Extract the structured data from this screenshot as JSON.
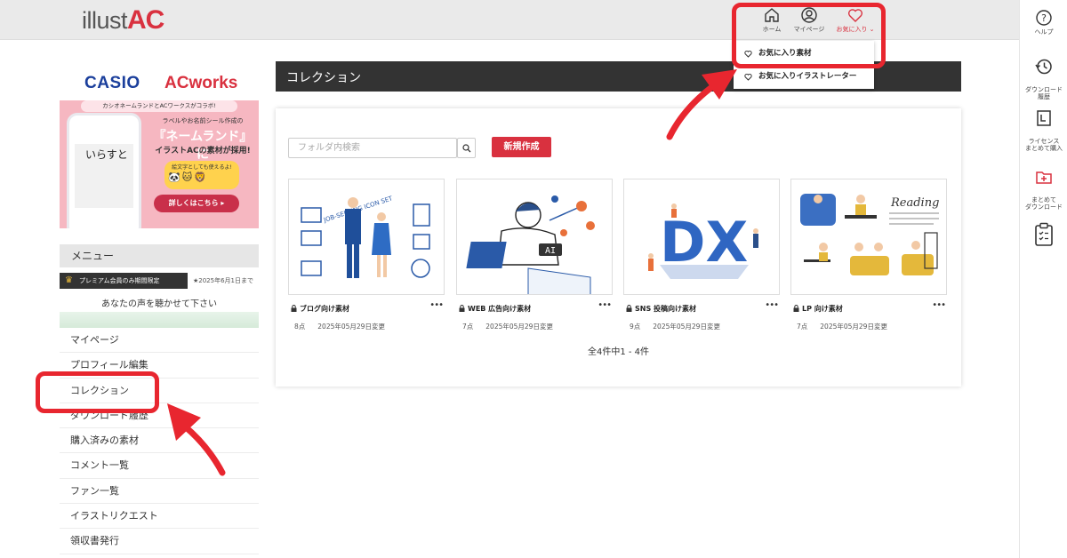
{
  "header": {
    "logo_text": "illust",
    "logo_accent": "AC",
    "nav": [
      {
        "label": "ホーム",
        "icon": "home-icon"
      },
      {
        "label": "マイページ",
        "icon": "user-icon"
      },
      {
        "label": "お気に入り ⌄",
        "icon": "heart-icon"
      }
    ],
    "help_label": "ヘルプ"
  },
  "favorites_dropdown": {
    "items": [
      "お気に入り素材",
      "お気に入りイラストレーター"
    ]
  },
  "rail": {
    "items": [
      {
        "label": "ダウンロード\n履歴",
        "icon": "history-icon"
      },
      {
        "label": "ライセンス\nまとめて購入",
        "icon": "license-icon"
      },
      {
        "label": "まとめて\nダウンロード",
        "icon": "folder-plus-icon"
      },
      {
        "label": "",
        "icon": "clipboard-icon"
      }
    ]
  },
  "banner": {
    "casio": "CASIO",
    "acworks": "ACworks",
    "sub": "カシオネームランドとACワークスがコラボ!",
    "line1": "ラベルやお名前シール作成の",
    "line2": "『ネームランド』に",
    "line3": "イラストACの素材が採用!",
    "tag": "絵文字としても使えるよ!",
    "phone_word": "いらすと",
    "button": "詳しくはこちら ▸"
  },
  "menu": {
    "title": "メニュー",
    "promo_bar": "プレミアム会員のみ期間限定",
    "promo_date": "★2025年6月1日まで",
    "promo_text": "あなたの声を聴かせて下さい",
    "items": [
      "マイページ",
      "プロフィール編集",
      "コレクション",
      "ダウンロード履歴",
      "購入済みの素材",
      "コメント一覧",
      "ファン一覧",
      "イラストリクエスト",
      "領収書発行"
    ]
  },
  "main": {
    "title": "コレクション",
    "search_placeholder": "フォルダ内検索",
    "new_button": "新規作成",
    "count_text": "全4件中1 - 4件",
    "cards": [
      {
        "title": "ブログ向け素材",
        "count": "8点",
        "date": "2025年05月29日変更",
        "art_text": "JOB-SEEKING ICON SET"
      },
      {
        "title": "WEB 広告向け素材",
        "count": "7点",
        "date": "2025年05月29日変更",
        "art_text": "AI"
      },
      {
        "title": "SNS 投稿向け素材",
        "count": "9点",
        "date": "2025年05月29日変更",
        "art_text": "DX"
      },
      {
        "title": "LP 向け素材",
        "count": "7点",
        "date": "2025年05月29日変更",
        "art_text": "Reading"
      }
    ]
  },
  "colors": {
    "brand_red": "#d9313f",
    "annotation_red": "#e8262f",
    "title_bar": "#333333"
  }
}
